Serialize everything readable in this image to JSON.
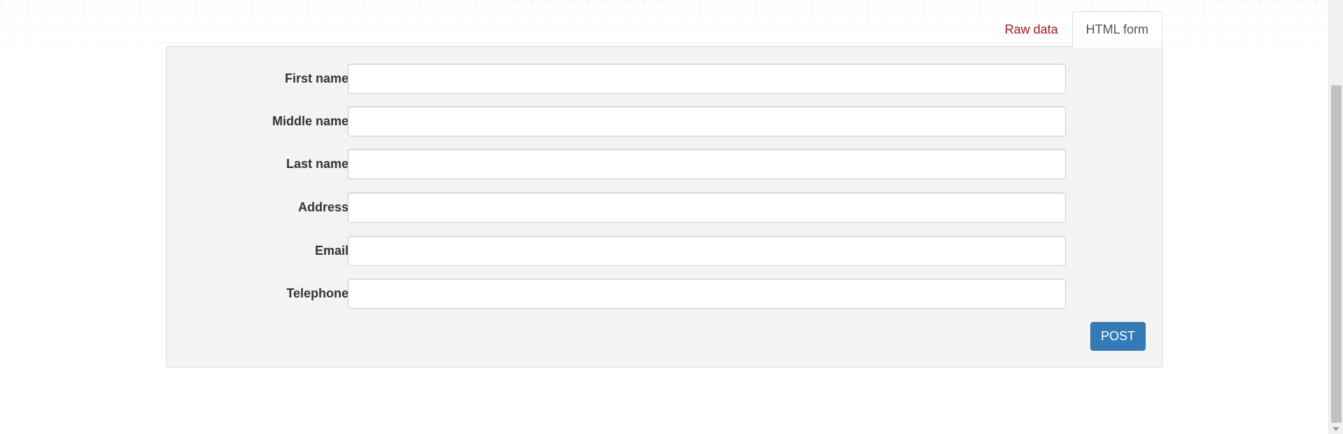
{
  "tabs": {
    "raw_data": "Raw data",
    "html_form": "HTML form",
    "active": "HTML form"
  },
  "form": {
    "fields": [
      {
        "label": "First name",
        "value": "",
        "placeholder": ""
      },
      {
        "label": "Middle name",
        "value": "",
        "placeholder": ""
      },
      {
        "label": "Last name",
        "value": "",
        "placeholder": ""
      },
      {
        "label": "Address",
        "value": "",
        "placeholder": ""
      },
      {
        "label": "Email",
        "value": "",
        "placeholder": ""
      },
      {
        "label": "Telephone",
        "value": "",
        "placeholder": ""
      }
    ],
    "submit_label": "POST"
  },
  "colors": {
    "tab_link": "#a11b1b",
    "primary_button": "#337ab7",
    "panel_background": "#f3f3f3"
  }
}
